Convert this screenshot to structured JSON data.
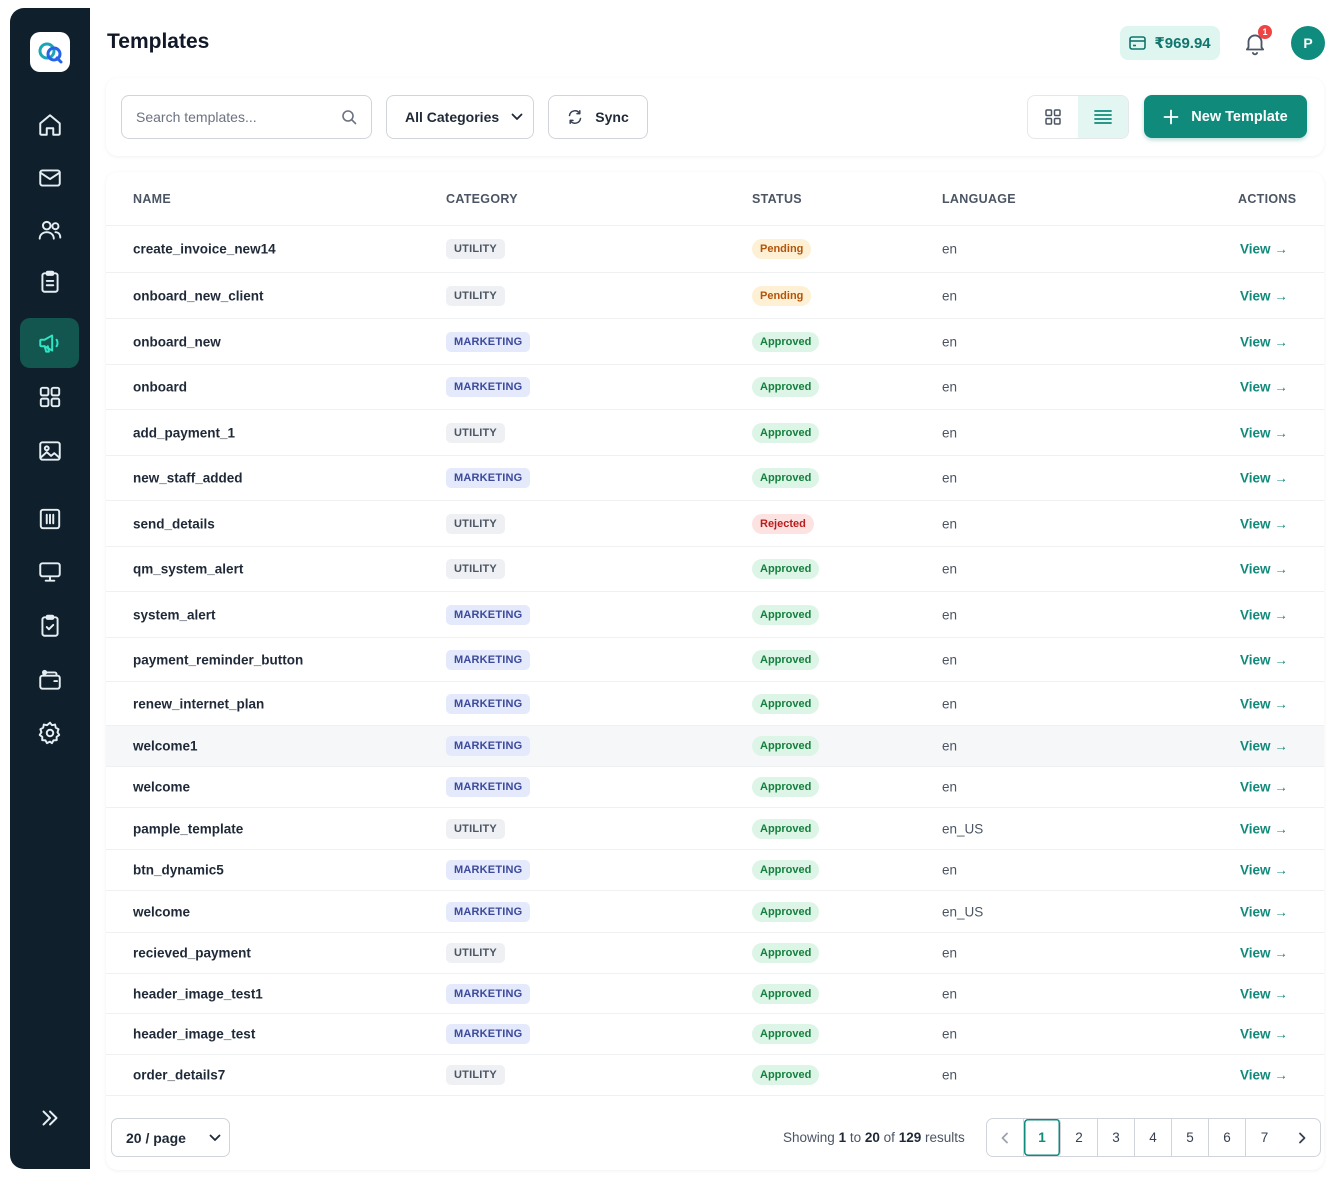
{
  "header": {
    "title": "Templates",
    "balance": "₹969.94",
    "notification_count": "1",
    "avatar_initial": "P"
  },
  "sidebar": {
    "items": [
      {
        "icon": "home-icon",
        "active": false
      },
      {
        "icon": "mail-icon",
        "active": false
      },
      {
        "icon": "users-icon",
        "active": false
      },
      {
        "icon": "clipboard-icon",
        "active": false
      },
      {
        "icon": "megaphone-icon",
        "active": true
      },
      {
        "icon": "grid-icon",
        "active": false
      },
      {
        "icon": "image-icon",
        "active": false
      },
      {
        "icon": "chart-icon",
        "active": false
      },
      {
        "icon": "monitor-icon",
        "active": false
      },
      {
        "icon": "clipboard-check-icon",
        "active": false
      },
      {
        "icon": "wallet-icon",
        "active": false
      },
      {
        "icon": "settings-icon",
        "active": false
      }
    ],
    "expand_icon": "double-chevron-right-icon"
  },
  "toolbar": {
    "search_placeholder": "Search templates...",
    "category_select": "All Categories",
    "sync_label": "Sync",
    "new_template_label": "New Template"
  },
  "table": {
    "columns": [
      "NAME",
      "CATEGORY",
      "STATUS",
      "LANGUAGE",
      "ACTIONS"
    ],
    "action_label": "View →",
    "rows": [
      {
        "name": "create_invoice_new14",
        "category": "UTILITY",
        "status": "Pending",
        "language": "en"
      },
      {
        "name": "onboard_new_client",
        "category": "UTILITY",
        "status": "Pending",
        "language": "en"
      },
      {
        "name": "onboard_new",
        "category": "MARKETING",
        "status": "Approved",
        "language": "en"
      },
      {
        "name": "onboard",
        "category": "MARKETING",
        "status": "Approved",
        "language": "en"
      },
      {
        "name": "add_payment_1",
        "category": "UTILITY",
        "status": "Approved",
        "language": "en"
      },
      {
        "name": "new_staff_added",
        "category": "MARKETING",
        "status": "Approved",
        "language": "en"
      },
      {
        "name": "send_details",
        "category": "UTILITY",
        "status": "Rejected",
        "language": "en"
      },
      {
        "name": "qm_system_alert",
        "category": "UTILITY",
        "status": "Approved",
        "language": "en"
      },
      {
        "name": "system_alert",
        "category": "MARKETING",
        "status": "Approved",
        "language": "en"
      },
      {
        "name": "payment_reminder_button",
        "category": "MARKETING",
        "status": "Approved",
        "language": "en"
      },
      {
        "name": "renew_internet_plan",
        "category": "MARKETING",
        "status": "Approved",
        "language": "en"
      },
      {
        "name": "welcome1",
        "category": "MARKETING",
        "status": "Approved",
        "language": "en"
      },
      {
        "name": "welcome",
        "category": "MARKETING",
        "status": "Approved",
        "language": "en"
      },
      {
        "name": "pample_template",
        "category": "UTILITY",
        "status": "Approved",
        "language": "en_US"
      },
      {
        "name": "btn_dynamic5",
        "category": "MARKETING",
        "status": "Approved",
        "language": "en"
      },
      {
        "name": "welcome",
        "category": "MARKETING",
        "status": "Approved",
        "language": "en_US"
      },
      {
        "name": "recieved_payment",
        "category": "UTILITY",
        "status": "Approved",
        "language": "en"
      },
      {
        "name": "header_image_test1",
        "category": "MARKETING",
        "status": "Approved",
        "language": "en"
      },
      {
        "name": "header_image_test",
        "category": "MARKETING",
        "status": "Approved",
        "language": "en"
      },
      {
        "name": "order_details7",
        "category": "UTILITY",
        "status": "Approved",
        "language": "en"
      }
    ]
  },
  "footer": {
    "per_page": "20 / page",
    "showing_prefix": "Showing",
    "showing_from": "1",
    "showing_to_word": "to",
    "showing_to": "20",
    "showing_of_word": "of",
    "showing_total": "129",
    "showing_suffix": "results",
    "pages": [
      "1",
      "2",
      "3",
      "4",
      "5",
      "6",
      "7"
    ],
    "current_page": "1"
  }
}
